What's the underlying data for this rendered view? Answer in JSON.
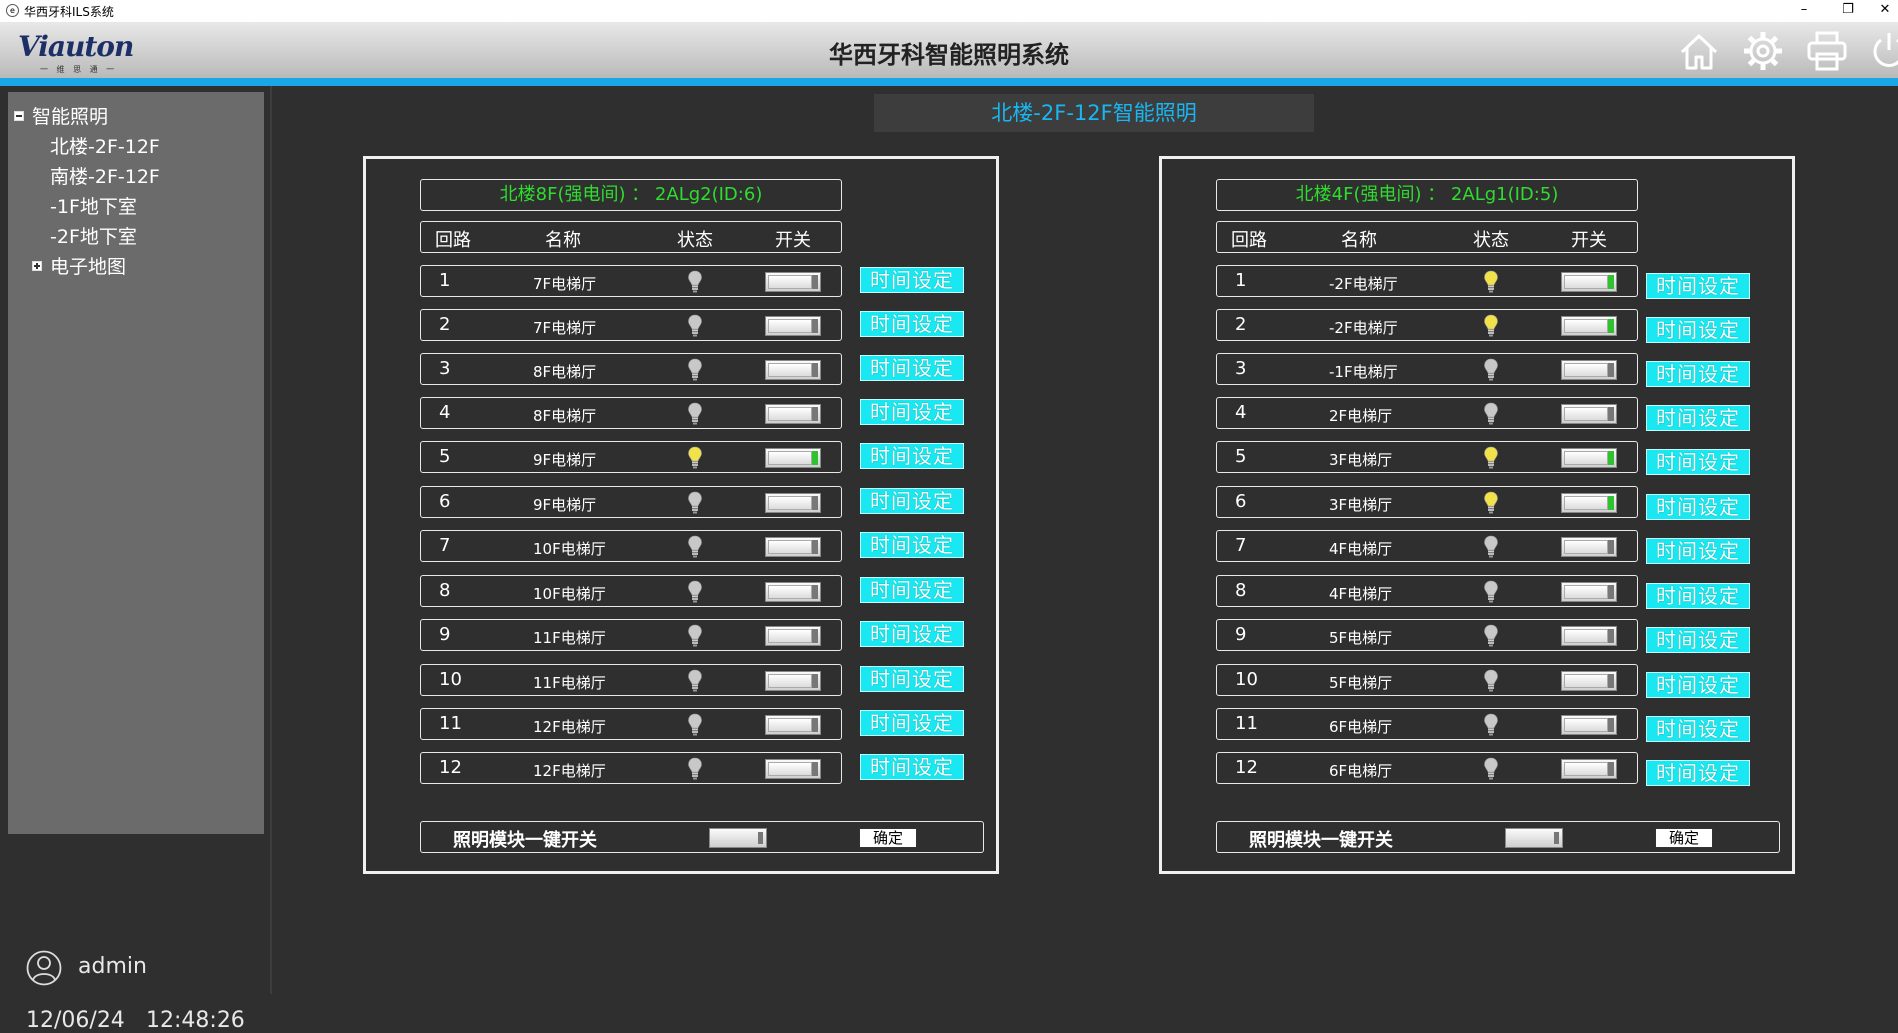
{
  "window": {
    "title": "华西牙科ILS系统",
    "min": "–",
    "restore": "❐",
    "close": "✕"
  },
  "header": {
    "logo": "Viauton",
    "logo_sub": "一 维 思 通 一",
    "title": "华西牙科智能照明系统"
  },
  "sidebar": {
    "root": "智能照明",
    "items": [
      "北楼-2F-12F",
      "南楼-2F-12F",
      "-1F地下室",
      "-2F地下室"
    ],
    "map": "电子地图",
    "user": "admin",
    "date": "12/06/24",
    "time": "12:48:26"
  },
  "main": {
    "title": "北楼-2F-12F智能照明"
  },
  "columns": {
    "loop": "回路",
    "name": "名称",
    "status": "状态",
    "switch": "开关"
  },
  "time_btn_label": "时间设定",
  "master_label": "照明模块一键开关",
  "confirm_label": "确定",
  "colors": {
    "accent": "#1aa7e6",
    "title_green": "#2fdc2f",
    "time_btn": "#19e8f2",
    "bulb_on": "#f2e24a",
    "bulb_off": "#c8c8c8"
  },
  "panels": [
    {
      "title": "北楼8F(强电间) ： 2ALg2(ID:6)",
      "rows": [
        {
          "num": "1",
          "name": "7F电梯厅",
          "on": false
        },
        {
          "num": "2",
          "name": "7F电梯厅",
          "on": false
        },
        {
          "num": "3",
          "name": "8F电梯厅",
          "on": false
        },
        {
          "num": "4",
          "name": "8F电梯厅",
          "on": false
        },
        {
          "num": "5",
          "name": "9F电梯厅",
          "on": true
        },
        {
          "num": "6",
          "name": "9F电梯厅",
          "on": false
        },
        {
          "num": "7",
          "name": "10F电梯厅",
          "on": false
        },
        {
          "num": "8",
          "name": "10F电梯厅",
          "on": false
        },
        {
          "num": "9",
          "name": "11F电梯厅",
          "on": false
        },
        {
          "num": "10",
          "name": "11F电梯厅",
          "on": false
        },
        {
          "num": "11",
          "name": "12F电梯厅",
          "on": false
        },
        {
          "num": "12",
          "name": "12F电梯厅",
          "on": false
        }
      ]
    },
    {
      "title": "北楼4F(强电间) ： 2ALg1(ID:5)",
      "rows": [
        {
          "num": "1",
          "name": "-2F电梯厅",
          "on": true
        },
        {
          "num": "2",
          "name": "-2F电梯厅",
          "on": true
        },
        {
          "num": "3",
          "name": "-1F电梯厅",
          "on": false
        },
        {
          "num": "4",
          "name": "2F电梯厅",
          "on": false
        },
        {
          "num": "5",
          "name": "3F电梯厅",
          "on": true
        },
        {
          "num": "6",
          "name": "3F电梯厅",
          "on": true
        },
        {
          "num": "7",
          "name": "4F电梯厅",
          "on": false
        },
        {
          "num": "8",
          "name": "4F电梯厅",
          "on": false
        },
        {
          "num": "9",
          "name": "5F电梯厅",
          "on": false
        },
        {
          "num": "10",
          "name": "5F电梯厅",
          "on": false
        },
        {
          "num": "11",
          "name": "6F电梯厅",
          "on": false
        },
        {
          "num": "12",
          "name": "6F电梯厅",
          "on": false
        }
      ]
    }
  ]
}
